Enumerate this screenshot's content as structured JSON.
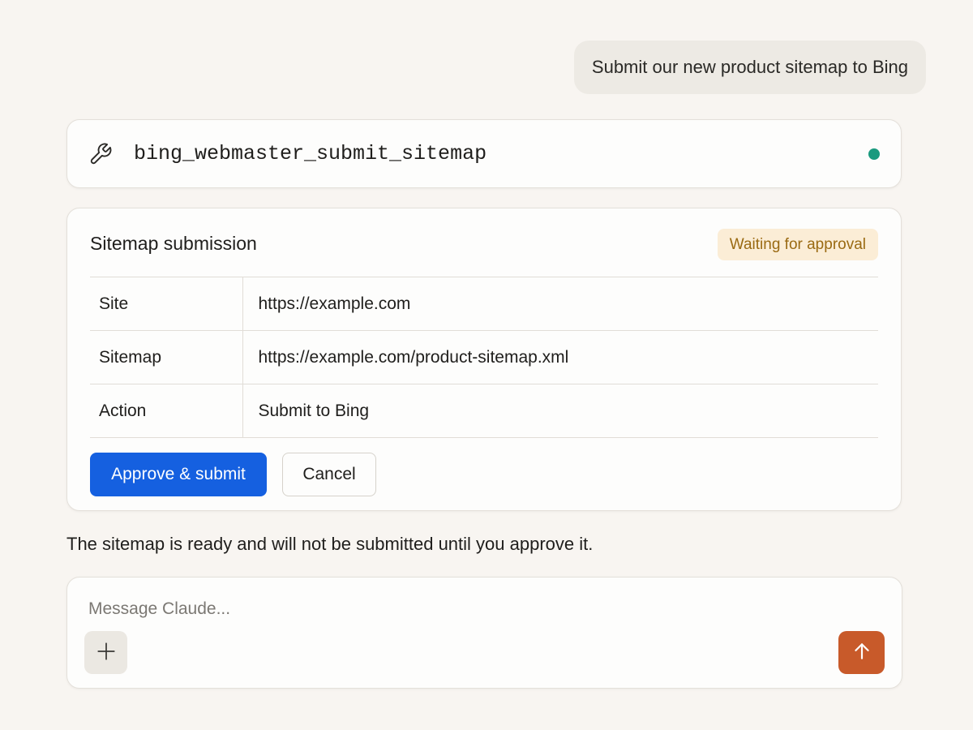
{
  "conversation": {
    "user_message": "Submit our new product sitemap to Bing",
    "assistant_message": "The sitemap is ready and will not be submitted until you approve it."
  },
  "tool": {
    "name": "bing_webmaster_submit_sitemap",
    "icon": "wrench-icon",
    "status_color": "#1a9a7e"
  },
  "approval": {
    "title": "Sitemap submission",
    "badge": "Waiting for approval",
    "rows": [
      {
        "label": "Site",
        "value": "https://example.com"
      },
      {
        "label": "Sitemap",
        "value": "https://example.com/product-sitemap.xml"
      },
      {
        "label": "Action",
        "value": "Submit to Bing"
      }
    ],
    "approve_label": "Approve & submit",
    "cancel_label": "Cancel",
    "approve_color": "#1560e0"
  },
  "composer": {
    "placeholder": "Message Claude...",
    "value": "",
    "attach_icon": "plus-icon",
    "send_icon": "arrow-up-icon",
    "send_color": "#c85a2a"
  }
}
